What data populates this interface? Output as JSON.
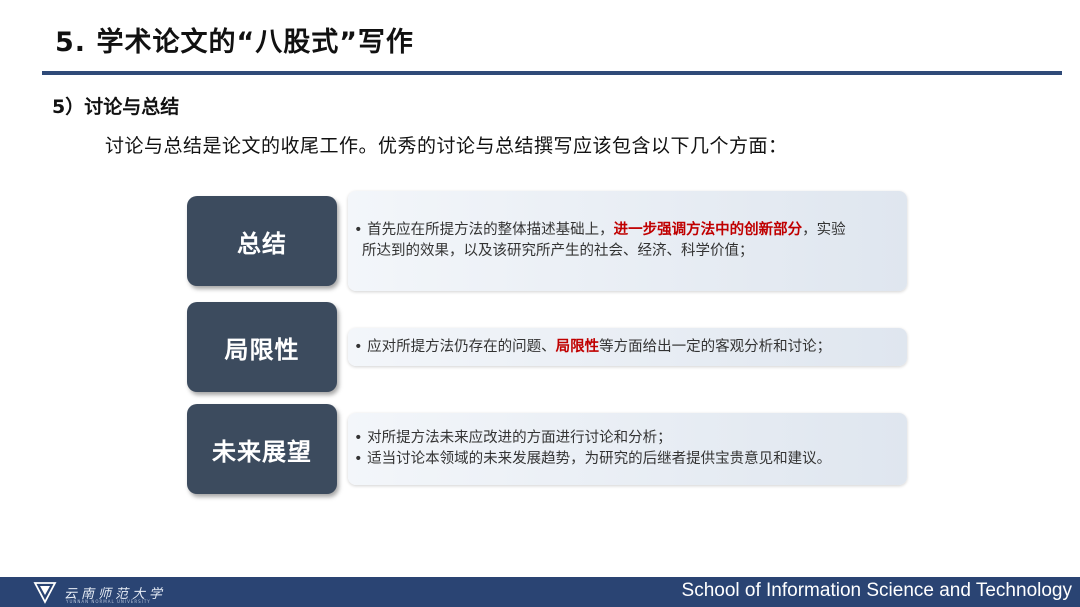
{
  "slide": {
    "title": "5. 学术论文的“八股式”写作",
    "section_heading": "5）讨论与总结",
    "intro": "讨论与总结是论文的收尾工作。优秀的讨论与总结撰写应该包含以下几个方面："
  },
  "rows": [
    {
      "label": "总结",
      "line1_pre": "• 首先应在所提方法的整体描述基础上，",
      "line1_hl": "进一步强调方法中的创新部分",
      "line1_post": "，实验",
      "line2": "所达到的效果，以及该研究所产生的社会、经济、科学价值；"
    },
    {
      "label": "局限性",
      "line1_pre": "• 应对所提方法仍存在的问题、",
      "line1_hl": "局限性",
      "line1_post": "等方面给出一定的客观分析和讨论；"
    },
    {
      "label": "未来展望",
      "line1": "• 对所提方法未来应改进的方面进行讨论和分析；",
      "line2": "• 适当讨论本领域的未来发展趋势，为研究的后继者提供宝贵意见和建议。"
    }
  ],
  "footer": {
    "university_logo_text": "云南师范大学",
    "university_logo_subtext": "YUNNAN NORMAL UNIVERSITY",
    "school": "School of Information Science and Technology"
  },
  "colors": {
    "title_rule": "#2f4a78",
    "label_box": "#3c4b5e",
    "highlight": "#c00000",
    "footer_bar": "#2a4473"
  },
  "icons": [
    "university-logo-icon"
  ]
}
